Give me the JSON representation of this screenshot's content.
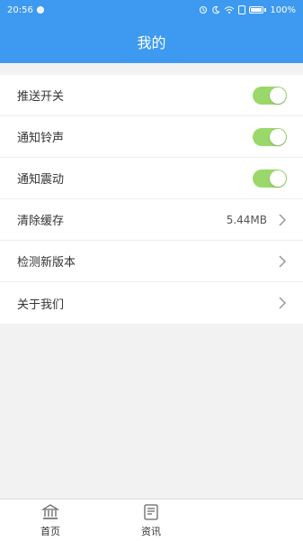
{
  "status_bar": {
    "time": "20:56",
    "battery": "100%",
    "icons": [
      "notification-dot-icon",
      "alarm-icon",
      "moon-icon",
      "wifi-icon",
      "sim-icon",
      "battery-icon"
    ]
  },
  "header": {
    "title": "我的"
  },
  "menu": {
    "items": [
      {
        "label": "推送开关",
        "type": "toggle",
        "on": true
      },
      {
        "label": "通知铃声",
        "type": "toggle",
        "on": true
      },
      {
        "label": "通知震动",
        "type": "toggle",
        "on": true
      },
      {
        "label": "清除缓存",
        "type": "arrow",
        "value": "5.44MB"
      },
      {
        "label": "检测新版本",
        "type": "arrow"
      },
      {
        "label": "关于我们",
        "type": "arrow"
      }
    ]
  },
  "tabbar": {
    "tabs": [
      {
        "label": "首页",
        "icon": "bank-icon"
      },
      {
        "label": "资讯",
        "icon": "document-icon"
      }
    ]
  },
  "colors": {
    "primary": "#3d9af0",
    "toggle_on": "#9bd86b",
    "background": "#f2f2f2"
  }
}
